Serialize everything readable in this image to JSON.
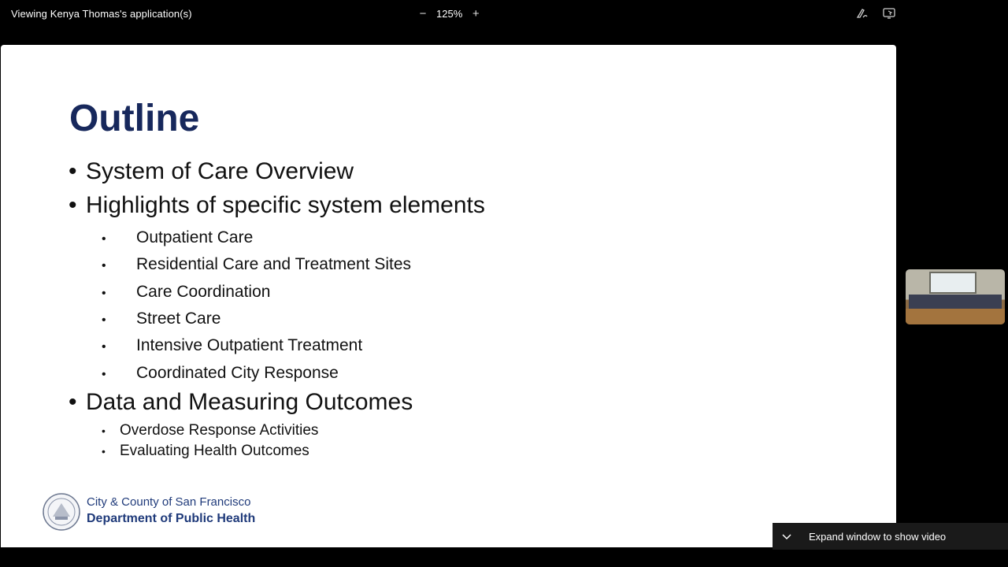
{
  "topbar": {
    "share_title": "Viewing Kenya Thomas's application(s)",
    "zoom_level": "125%",
    "zoom_out_label": "−",
    "zoom_in_label": "+"
  },
  "slide": {
    "title": "Outline",
    "bullets": [
      "System of Care Overview",
      "Highlights of specific system elements"
    ],
    "sub_bullets": [
      "Outpatient Care",
      "Residential Care and Treatment Sites",
      "Care Coordination",
      "Street Care",
      "Intensive Outpatient Treatment",
      "Coordinated City Response"
    ],
    "bullet3": "Data and Measuring Outcomes",
    "sub_bullets2": [
      "Overdose Response Activities",
      "Evaluating Health Outcomes"
    ],
    "org_line1": "City & County of San Francisco",
    "org_line2": "Department of Public Health",
    "bullet_glyph": "•"
  },
  "video": {
    "expand_label": "Expand window to show video"
  },
  "icons": {
    "annotate": "pen-annotate-icon",
    "remote_control": "remote-control-icon",
    "chevron": "chevron-down-icon"
  },
  "colors": {
    "title": "#17285c",
    "org": "#1f3a7a",
    "background": "#000000"
  }
}
